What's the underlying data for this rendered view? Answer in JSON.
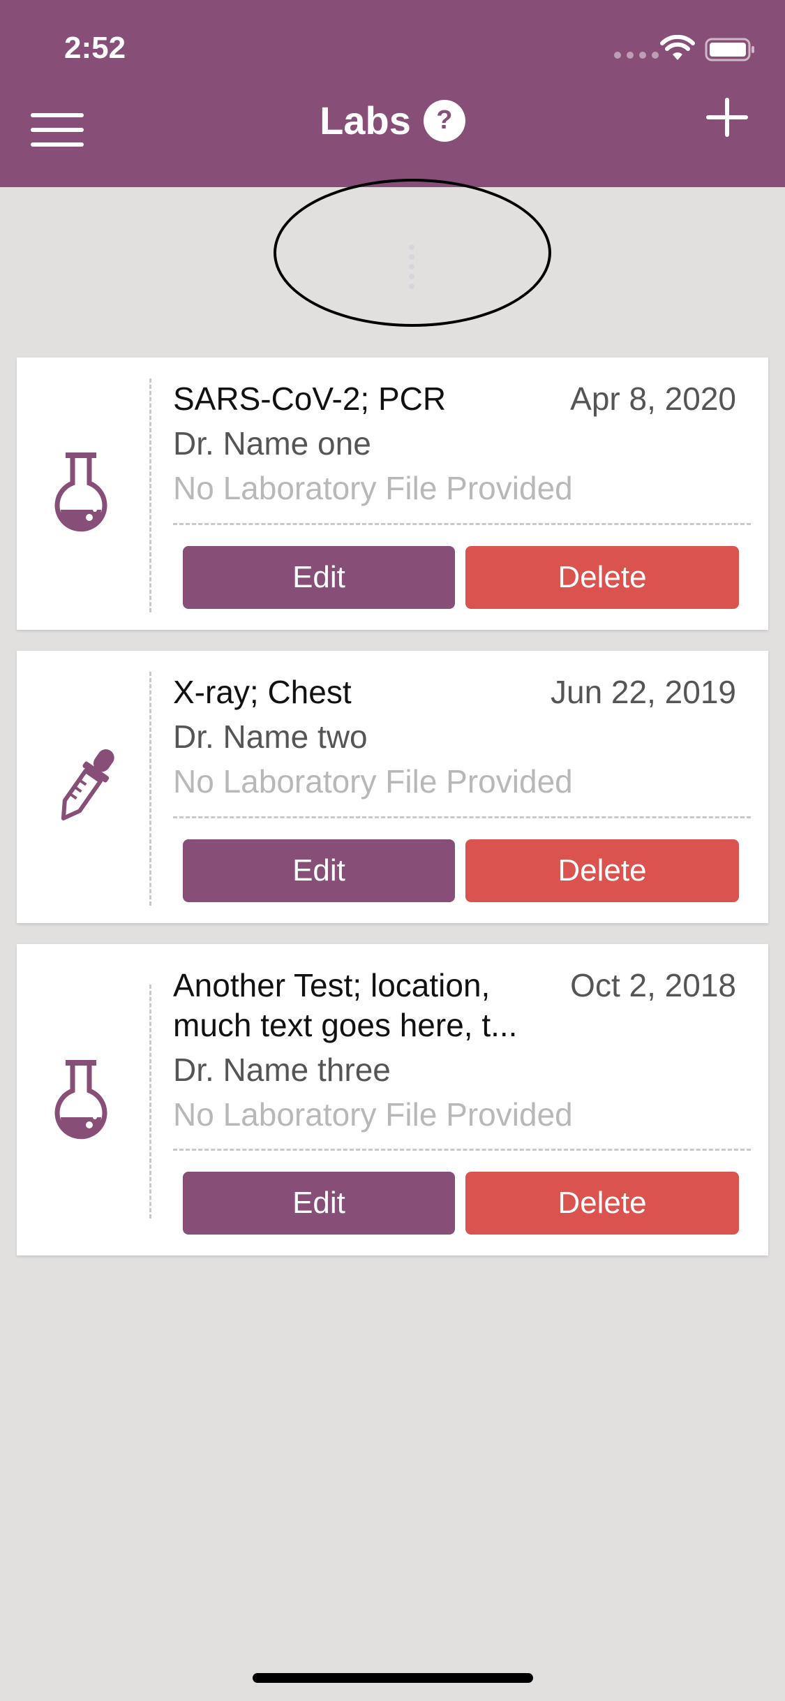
{
  "status_bar": {
    "time": "2:52"
  },
  "header": {
    "title": "Labs",
    "help_icon": "?",
    "menu_icon": "hamburger-icon",
    "add_icon": "plus-icon"
  },
  "colors": {
    "primary": "#874f77",
    "danger": "#da534f",
    "background": "#e2dfdf"
  },
  "labs": [
    {
      "title": "SARS-CoV-2; PCR",
      "date": "Apr 8, 2020",
      "doctor": "Dr. Name one",
      "file": "No Laboratory File Provided",
      "icon": "flask-icon",
      "edit_label": "Edit",
      "delete_label": "Delete"
    },
    {
      "title": "X-ray; Chest",
      "date": "Jun 22, 2019",
      "doctor": "Dr. Name two",
      "file": "No Laboratory File Provided",
      "icon": "dropper-icon",
      "edit_label": "Edit",
      "delete_label": "Delete"
    },
    {
      "title_line1": "Another Test; location,",
      "title_line2": "much text goes here, t...",
      "date": "Oct 2, 2018",
      "doctor": "Dr. Name three",
      "file": "No Laboratory File Provided",
      "icon": "flask-icon",
      "edit_label": "Edit",
      "delete_label": "Delete"
    }
  ]
}
